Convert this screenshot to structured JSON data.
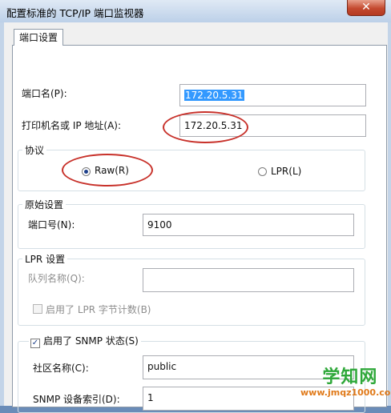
{
  "window": {
    "title": "配置标准的 TCP/IP 端口监视器",
    "close_glyph": "✕"
  },
  "tabs": [
    {
      "label": "端口设置"
    }
  ],
  "port_name": {
    "label": "端口名(P):",
    "value": "172.20.5.31"
  },
  "host_address": {
    "label": "打印机名或 IP 地址(A):",
    "value": "172.20.5.31"
  },
  "protocol": {
    "title": "协议",
    "options": [
      {
        "label": "Raw(R)",
        "selected": true
      },
      {
        "label": "LPR(L)",
        "selected": false
      }
    ]
  },
  "raw_settings": {
    "title": "原始设置",
    "port_number_label": "端口号(N):",
    "port_number_value": "9100"
  },
  "lpr_settings": {
    "title": "LPR 设置",
    "queue_name_label": "队列名称(Q):",
    "queue_name_value": "",
    "byte_counting_label": "启用了 LPR 字节计数(B)",
    "byte_counting_checked": false
  },
  "snmp": {
    "enabled_label": "启用了 SNMP 状态(S)",
    "enabled": true,
    "community_label": "社区名称(C):",
    "community_value": "public",
    "device_index_label": "SNMP 设备索引(D):",
    "device_index_value": "1"
  },
  "watermark": {
    "name": "学知网",
    "url": "www.jmqz1000.com"
  },
  "colors": {
    "highlight_ellipse": "#c8322b",
    "selection": "#3399ff"
  }
}
